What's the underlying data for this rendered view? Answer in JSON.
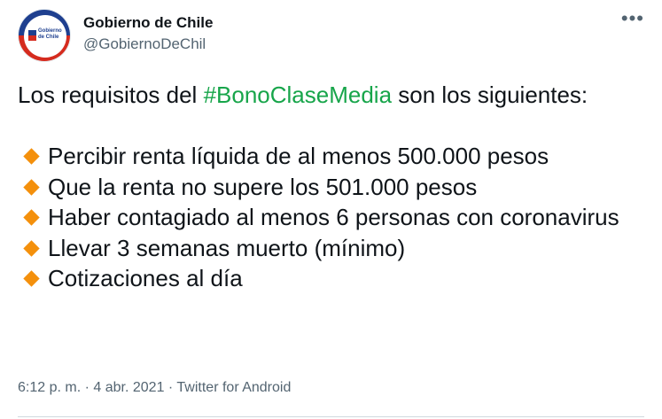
{
  "tweet": {
    "display_name": "Gobierno de Chile",
    "handle": "@GobiernoDeChil",
    "avatar_text": "Gobierno de Chile",
    "more_glyph": "•••",
    "text_before_hashtag": "Los requisitos del ",
    "hashtag": "#BonoClaseMedia",
    "text_after_hashtag": " son los siguientes:",
    "requirements": [
      "Percibir renta líquida de al menos 500.000 pesos",
      "Que la renta no supere los 501.000 pesos",
      "Haber contagiado al menos 6 personas con coronavirus",
      "Llevar 3 semanas muerto (mínimo)",
      "Cotizaciones al día"
    ],
    "bullet_icon": "orange-diamond-icon",
    "time": "6:12 p. m.",
    "separator": "·",
    "date": "4 abr. 2021",
    "source": "Twitter for Android"
  },
  "colors": {
    "hashtag": "#17a54a",
    "bullet": "#f4900c",
    "secondary_text": "#536471",
    "avatar_blue": "#1e3f8f",
    "avatar_red": "#d52b1e"
  }
}
